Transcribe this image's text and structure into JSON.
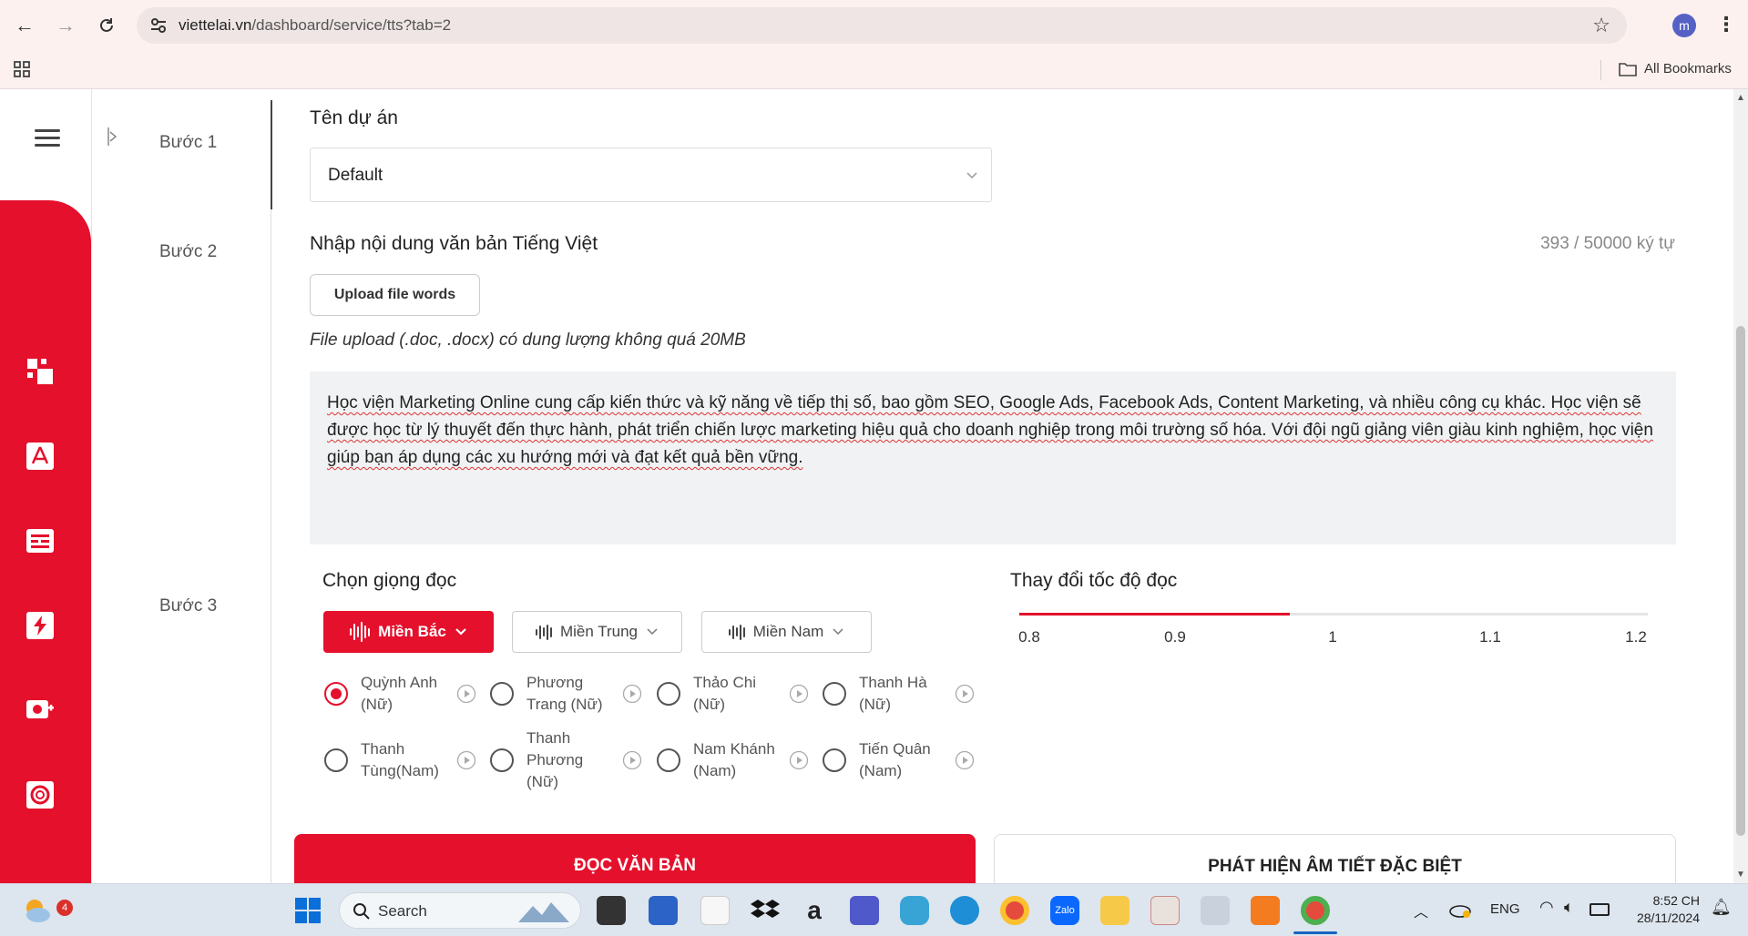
{
  "browser": {
    "url_host": "viettelai.vn",
    "url_path": "/dashboard/service/tts?tab=2",
    "profile_initial": "m",
    "all_bookmarks": "All Bookmarks"
  },
  "steps": {
    "step1": "Bước 1",
    "step2": "Bước 2",
    "step3": "Bước 3"
  },
  "project": {
    "title": "Tên dự án",
    "selected": "Default"
  },
  "content": {
    "title": "Nhập nội dung văn bản Tiếng Việt",
    "char_count": "393 / 50000 ký tự",
    "upload_label": "Upload file words",
    "upload_note": "File upload (.doc, .docx) có dung lượng không quá 20MB",
    "text": "Học viện Marketing Online cung cấp kiến thức và kỹ năng về tiếp thị số, bao gồm SEO, Google Ads, Facebook Ads, Content Marketing, và nhiều công cụ khác. Học viện sẽ được học từ lý thuyết đến thực hành, phát triển chiến lược marketing hiệu quả cho doanh nghiệp trong môi trường số hóa. Với đội ngũ giảng viên giàu kinh nghiệm, học viện giúp bạn áp dụng các xu hướng mới và đạt kết quả bền vững."
  },
  "voice": {
    "title": "Chọn giọng đọc",
    "regions": [
      {
        "label": "Miền Bắc",
        "active": true
      },
      {
        "label": "Miền Trung",
        "active": false
      },
      {
        "label": "Miền Nam",
        "active": false
      }
    ],
    "options": [
      {
        "name": "Quỳnh Anh (Nữ)",
        "selected": true
      },
      {
        "name": "Phương Trang (Nữ)",
        "selected": false
      },
      {
        "name": "Thảo Chi (Nữ)",
        "selected": false
      },
      {
        "name": "Thanh Hà (Nữ)",
        "selected": false
      },
      {
        "name": "Thanh Tùng(Nam)",
        "selected": false
      },
      {
        "name": "Thanh Phương (Nữ)",
        "selected": false
      },
      {
        "name": "Nam Khánh (Nam)",
        "selected": false
      },
      {
        "name": "Tiến Quân (Nam)",
        "selected": false
      }
    ]
  },
  "speed": {
    "title": "Thay đổi tốc độ đọc",
    "ticks": [
      "0.8",
      "0.9",
      "1",
      "1.1",
      "1.2"
    ],
    "value": 1,
    "min": 0.8,
    "max": 1.2
  },
  "actions": {
    "read": "ĐỌC VĂN BẢN",
    "detect": "PHÁT HIỆN ÂM TIẾT ĐẶC BIỆT"
  },
  "taskbar": {
    "weather_badge": "4",
    "search": "Search",
    "lang": "ENG",
    "time": "8:52 CH",
    "date": "28/11/2024"
  },
  "colors": {
    "accent": "#e5102c",
    "sidebar": "#e5102c"
  }
}
